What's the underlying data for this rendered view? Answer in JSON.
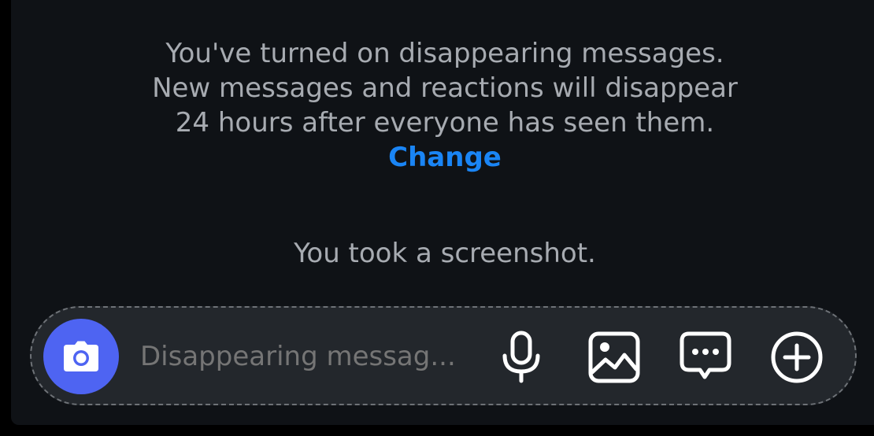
{
  "notice": {
    "lines": [
      "You've turned on disappearing messages.",
      "New messages and reactions will disappear",
      "24 hours after everyone has seen them."
    ],
    "change_label": "Change"
  },
  "system_message": "You took a screenshot.",
  "composer": {
    "placeholder": "Disappearing messag...",
    "camera_icon": "camera-icon",
    "tools": [
      "microphone-icon",
      "image-icon",
      "chat-bubble-dots-icon",
      "plus-circle-icon"
    ]
  },
  "colors": {
    "background": "#0f1216",
    "text": "#a7abb1",
    "link": "#1a85f5",
    "camera_button": "#4e64f2",
    "composer": "#23272c"
  }
}
